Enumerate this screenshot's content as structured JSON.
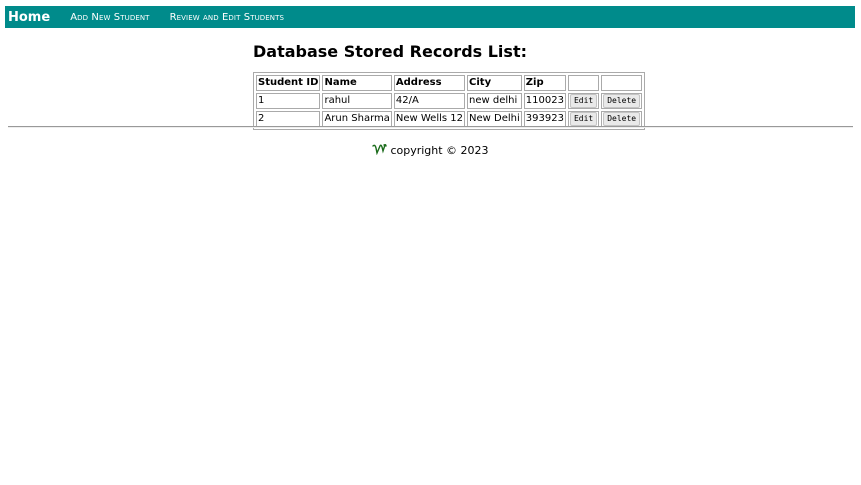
{
  "nav": {
    "home": "Home",
    "add_student": "Add New Student",
    "review_edit": "Review and Edit Students"
  },
  "page_title": "Database Stored Records List:",
  "table": {
    "headers": [
      "Student ID",
      "Name",
      "Address",
      "City",
      "Zip",
      "",
      ""
    ],
    "rows": [
      {
        "id": "1",
        "name": "rahul",
        "address": "42/A",
        "city": "new delhi",
        "zip": "110023",
        "edit": "Edit",
        "delete": "Delete"
      },
      {
        "id": "2",
        "name": "Arun Sharma",
        "address": "New Wells 12",
        "city": "New Delhi",
        "zip": "393923",
        "edit": "Edit",
        "delete": "Delete"
      }
    ]
  },
  "footer": {
    "copyright": "copyright © 2023"
  },
  "colors": {
    "nav_bg": "#008b8b",
    "logo": "#1a6b1a"
  }
}
